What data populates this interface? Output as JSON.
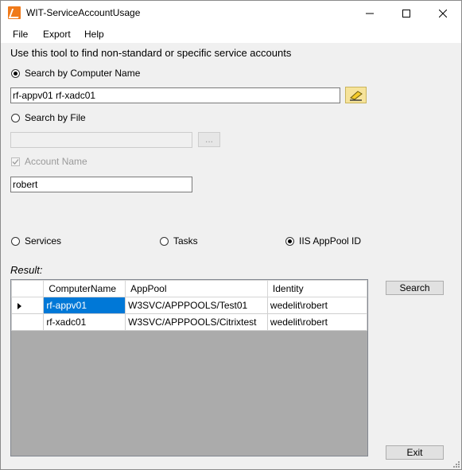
{
  "window": {
    "title": "WIT-ServiceAccountUsage"
  },
  "menu": {
    "file": "File",
    "export": "Export",
    "help": "Help"
  },
  "hint": "Use this tool to find non-standard or specific service accounts",
  "search_by_computer": {
    "label": "Search by Computer Name",
    "selected": true,
    "value": "rf-appv01 rf-xadc01"
  },
  "search_by_file": {
    "label": "Search by File",
    "selected": false,
    "value": "",
    "browse_label": "..."
  },
  "account_name": {
    "label": "Account Name",
    "checked": true,
    "value": "robert"
  },
  "modes": {
    "services": "Services",
    "tasks": "Tasks",
    "iis": "IIS AppPool ID",
    "selected": "iis"
  },
  "result": {
    "label": "Result:",
    "columns": [
      "ComputerName",
      "AppPool",
      "Identity"
    ],
    "rows": [
      [
        "rf-appv01",
        "W3SVC/APPPOOLS/Test01",
        "wedelit\\robert"
      ],
      [
        "rf-xadc01",
        "W3SVC/APPPOOLS/Citrixtest",
        "wedelit\\robert"
      ]
    ]
  },
  "buttons": {
    "search": "Search",
    "exit": "Exit"
  },
  "colors": {
    "selection": "#0078d7",
    "app_icon": "#f07a1a"
  }
}
